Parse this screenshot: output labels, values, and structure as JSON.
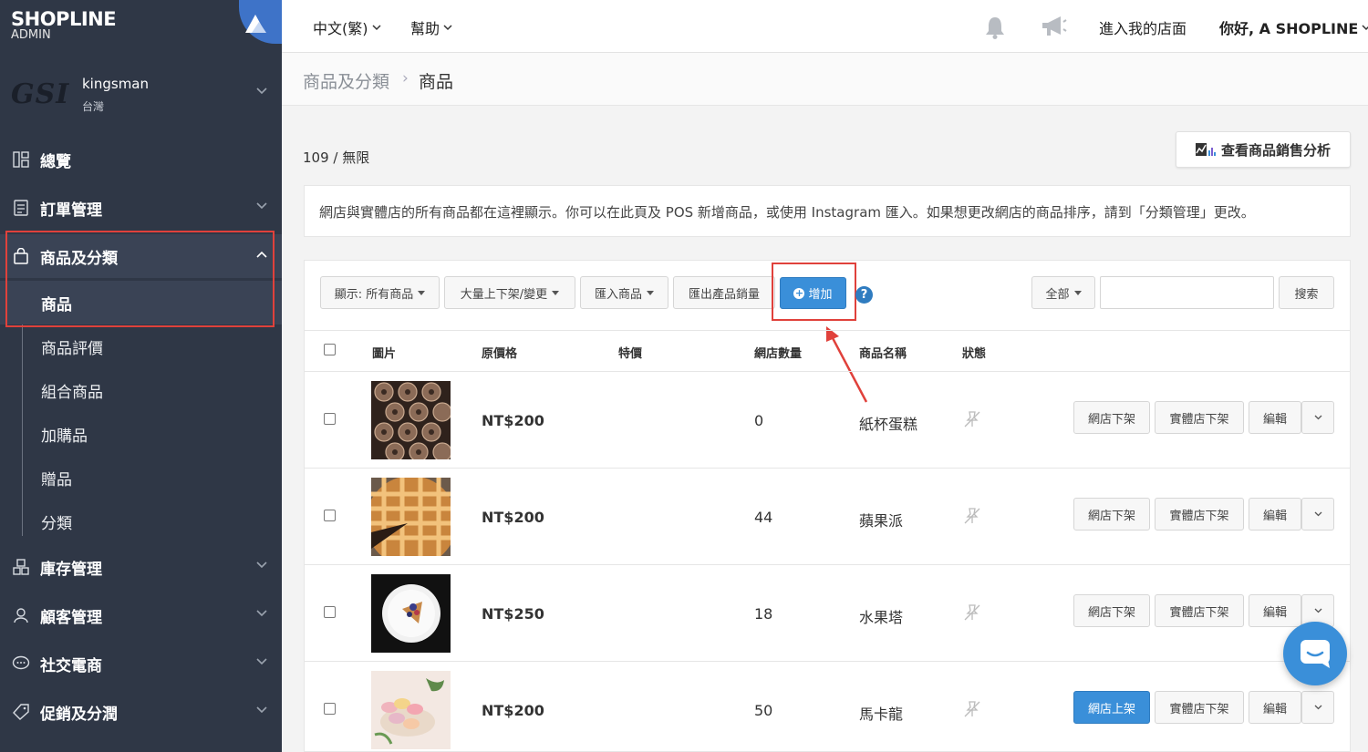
{
  "brand": {
    "logo_main": "SHOPLINE",
    "logo_sub": "ADMIN"
  },
  "store": {
    "logo_text": "GSI",
    "name": "kingsman",
    "region": "台灣"
  },
  "sidebar": {
    "items": [
      {
        "label": "總覽",
        "icon": "dashboard-icon"
      },
      {
        "label": "訂單管理",
        "icon": "order-icon"
      },
      {
        "label": "商品及分類",
        "icon": "shopping-bag-icon"
      },
      {
        "label": "庫存管理",
        "icon": "inventory-icon"
      },
      {
        "label": "顧客管理",
        "icon": "customer-icon"
      },
      {
        "label": "社交電商",
        "icon": "chat-icon"
      },
      {
        "label": "促銷及分潤",
        "icon": "tag-icon"
      }
    ],
    "sub_items": [
      "商品",
      "商品評價",
      "組合商品",
      "加購品",
      "贈品",
      "分類"
    ]
  },
  "topbar": {
    "language": "中文(繁)",
    "help": "幫助",
    "enter_store": "進入我的店面",
    "greeting": "你好, A SHOPLINE"
  },
  "breadcrumb": {
    "root": "商品及分類",
    "separator": "›",
    "leaf": "商品"
  },
  "header": {
    "count": "109 / 無限",
    "analysis_button": "查看商品銷售分析"
  },
  "notice": "網店與實體店的所有商品都在這裡顯示。你可以在此頁及 POS 新增商品，或使用 Instagram 匯入。如果想更改網店的商品排序，請到「分類管理」更改。",
  "toolbar": {
    "display_filter": "顯示: 所有商品",
    "bulk_update": "大量上下架/變更",
    "import": "匯入商品",
    "export_sales": "匯出產品銷量",
    "add": "增加",
    "help": "?",
    "scope": "全部",
    "search_value": "",
    "search_button": "搜索"
  },
  "table": {
    "columns": [
      "圖片",
      "原價格",
      "特價",
      "網店數量",
      "商品名稱",
      "狀態"
    ],
    "rows": [
      {
        "image": "cupcake-photo",
        "price": "NT$200",
        "special": "",
        "qty": "0",
        "name": "紙杯蛋糕",
        "online_action": "網店下架",
        "store_action": "實體店下架",
        "edit": "編輯",
        "online_active": false
      },
      {
        "image": "apple-pie-photo",
        "price": "NT$200",
        "special": "",
        "qty": "44",
        "name": "蘋果派",
        "online_action": "網店下架",
        "store_action": "實體店下架",
        "edit": "編輯",
        "online_active": false
      },
      {
        "image": "fruit-tart-photo",
        "price": "NT$250",
        "special": "",
        "qty": "18",
        "name": "水果塔",
        "online_action": "網店下架",
        "store_action": "實體店下架",
        "edit": "編輯",
        "online_active": false
      },
      {
        "image": "macaron-photo",
        "price": "NT$200",
        "special": "",
        "qty": "50",
        "name": "馬卡龍",
        "online_action": "網店上架",
        "store_action": "實體店下架",
        "edit": "編輯",
        "online_active": true
      }
    ]
  },
  "colors": {
    "sidebar_bg": "#2f3746",
    "primary": "#3a8fd9",
    "highlight": "#e0413b"
  }
}
